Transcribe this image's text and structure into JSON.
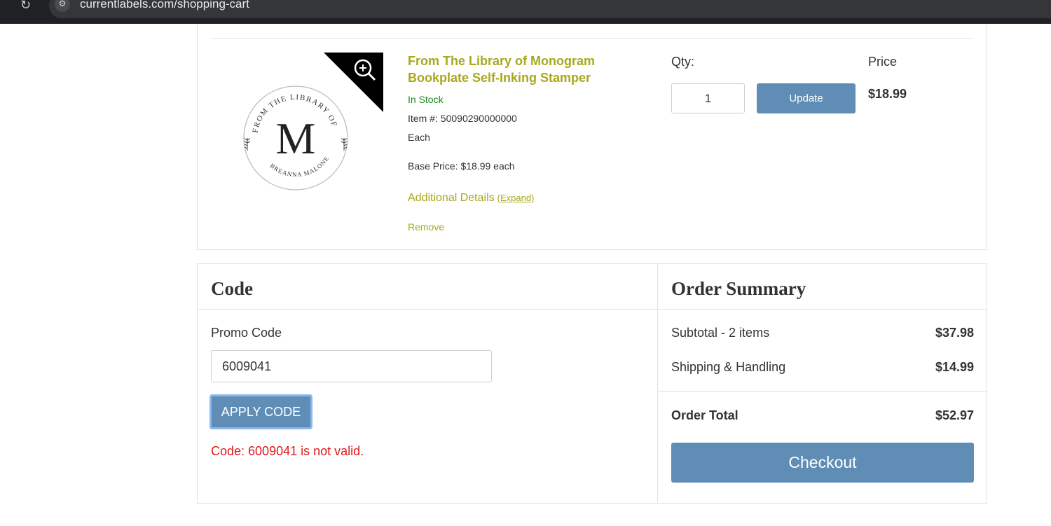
{
  "browser": {
    "url": "currentlabels.com/shopping-cart",
    "reload_icon": "reload-icon",
    "site_info_icon": "site-info-icon"
  },
  "cart_item": {
    "title_line1": "From The Library of Monogram",
    "title_line2": "Bookplate Self-Inking Stamper",
    "stock_status": "In Stock",
    "item_number_label": "Item #:",
    "item_number": "50090290000000",
    "unit": "Each",
    "base_price": "Base Price: $18.99 each",
    "additional_details": "Additional Details",
    "expand_link": "(Expand)",
    "remove_link": "Remove",
    "qty_label": "Qty:",
    "qty_value": "1",
    "update_button": "Update",
    "price_label": "Price",
    "price_value": "$18.99",
    "image": {
      "monogram_letter": "M",
      "arc_top_text": "FROM THE LIBRARY OF",
      "arc_bottom_text": "BREANNA MALONEY",
      "zoom_icon": "zoom-in-icon"
    }
  },
  "code_panel": {
    "title": "Code",
    "promo_label": "Promo Code",
    "promo_value": "6009041",
    "apply_button": "APPLY CODE",
    "error_message": "Code: 6009041 is not valid."
  },
  "order_summary": {
    "title": "Order Summary",
    "subtotal_label": "Subtotal - 2 items",
    "subtotal_value": "$37.98",
    "shipping_label": "Shipping & Handling",
    "shipping_value": "$14.99",
    "total_label": "Order Total",
    "total_value": "$52.97",
    "checkout_button": "Checkout"
  },
  "colors": {
    "accent_olive": "#a7a81c",
    "button_blue": "#5f8db6",
    "error_red": "#e01818",
    "in_stock_green": "#1a8a1a"
  }
}
